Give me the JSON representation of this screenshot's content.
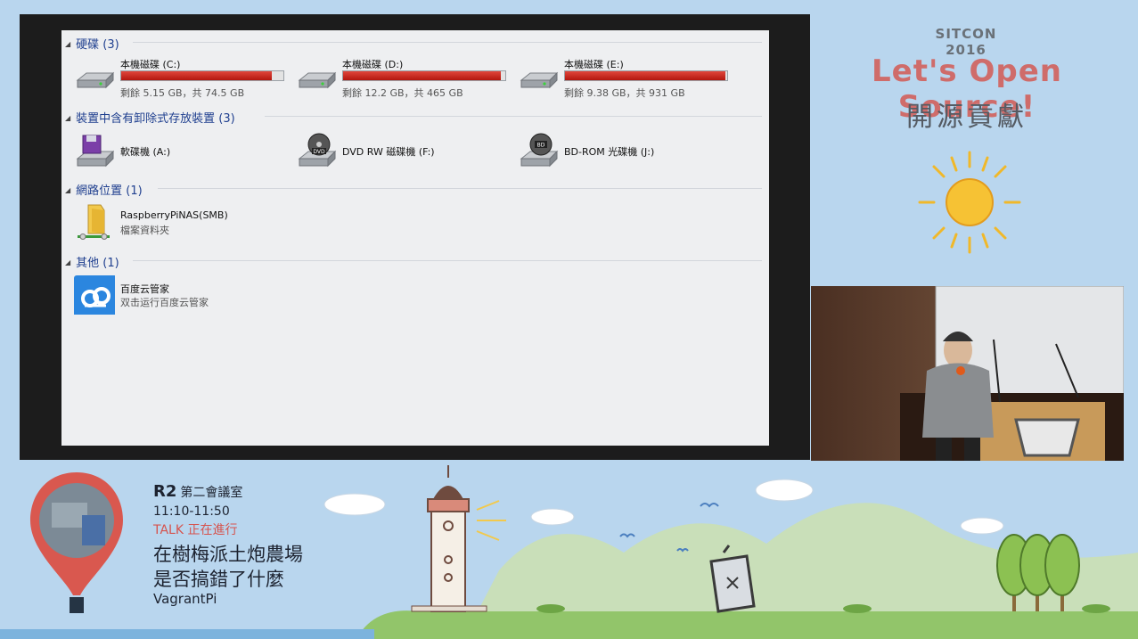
{
  "event": {
    "name": "SITCON  2016",
    "slogan_en": "Let's Open Source!",
    "slogan_zh": "開源貢獻"
  },
  "explorer": {
    "groups": [
      {
        "label": "硬碟 (3)"
      },
      {
        "label": "裝置中含有卸除式存放裝置 (3)"
      },
      {
        "label": "網路位置 (1)"
      },
      {
        "label": "其他 (1)"
      }
    ],
    "drives": [
      {
        "name": "本機磁碟 (C:)",
        "free": "剩餘 5.15 GB，共 74.5 GB",
        "used_fraction": 0.93
      },
      {
        "name": "本機磁碟 (D:)",
        "free": "剩餘 12.2 GB，共 465 GB",
        "used_fraction": 0.97
      },
      {
        "name": "本機磁碟 (E:)",
        "free": "剩餘 9.38 GB，共 931 GB",
        "used_fraction": 0.99
      }
    ],
    "removable": [
      {
        "name": "軟碟機 (A:)",
        "icon": "floppy-drive-icon"
      },
      {
        "name": "DVD RW 磁碟機 (F:)",
        "icon": "dvd-drive-icon",
        "badge": "DVD"
      },
      {
        "name": "BD-ROM 光碟機 (J:)",
        "icon": "bd-drive-icon",
        "badge": "BD"
      }
    ],
    "network": [
      {
        "name": "RaspberryPiNAS(SMB)",
        "sub": "檔案資料夾",
        "icon": "network-folder-icon"
      }
    ],
    "other": [
      {
        "name": "百度云管家",
        "sub": "双击运行百度云管家",
        "icon": "baidu-cloud-icon"
      }
    ]
  },
  "talk": {
    "room": "R2",
    "room_name": "第二會議室",
    "time": "11:10-11:50",
    "status": "TALK 正在進行",
    "title_line1": "在樹梅派土炮農場",
    "title_line2": "是否搞錯了什麼",
    "speaker": "VagrantPi"
  },
  "colors": {
    "background": "#b9d6ee",
    "accent_red": "#cf6c6a",
    "group_header": "#1f3f8f",
    "drive_bar": "#c8251b"
  }
}
